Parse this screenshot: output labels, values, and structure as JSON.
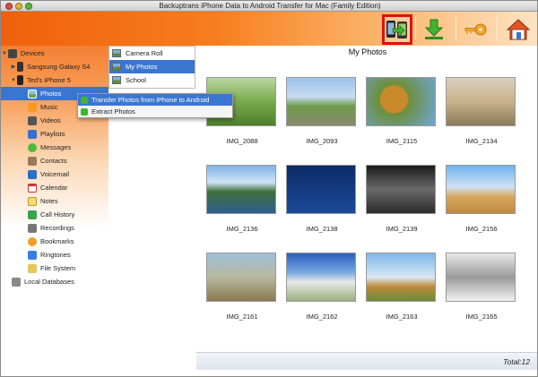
{
  "window": {
    "title": "Backuptrans iPhone Data to Android Transfer for Mac (Family Edition)"
  },
  "sidebar": {
    "devices_label": "Devices",
    "device_1": "Sangsung Galaxy S4",
    "device_2": "Ted's iPhone 5",
    "items": [
      "Photos",
      "Music",
      "Videos",
      "Playlists",
      "Messages",
      "Contacts",
      "Voicemail",
      "Calendar",
      "Notes",
      "Call History",
      "Recordings",
      "Bookmarks",
      "Ringtones",
      "File System"
    ],
    "local_label": "Local Databases"
  },
  "albums": [
    "Camera Roll",
    "My Photos",
    "School"
  ],
  "context_menu": [
    "Transfer Photos from iPhone to Android",
    "Extract Photos"
  ],
  "main": {
    "title": "My Photos",
    "photos": [
      "IMG_2088",
      "IMG_2093",
      "IMG_2115",
      "IMG_2134",
      "IMG_2136",
      "IMG_2138",
      "IMG_2139",
      "IMG_2156",
      "IMG_2161",
      "IMG_2162",
      "IMG_2163",
      "IMG_2165"
    ],
    "total": "Total:12"
  },
  "toolbar": [
    "transfer-phones-icon",
    "download-icon",
    "key-icon",
    "home-icon"
  ],
  "colors": {
    "accent_selection": "#3a76d0",
    "highlight_border": "#e01010",
    "header_orange": "#f0600c"
  }
}
